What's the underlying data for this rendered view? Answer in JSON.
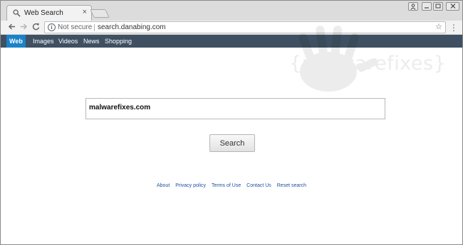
{
  "browser": {
    "tab_title": "Web Search",
    "tab_close": "×",
    "address": {
      "security_label": "Not secure",
      "url": "search.danabing.com"
    }
  },
  "site_nav": {
    "items": [
      "Web",
      "Images",
      "Videos",
      "News",
      "Shopping"
    ],
    "active": "Web"
  },
  "watermark": "{malwarefixes}",
  "search": {
    "query": "malwarefixes.com",
    "button_label": "Search"
  },
  "footer": {
    "links": [
      "About",
      "Privacy policy",
      "Terms of Use",
      "Contact Us",
      "Reset search"
    ]
  },
  "colors": {
    "nav_bar": "#3e5061",
    "nav_active": "#1a82c8",
    "footer_link": "#1f4fa3"
  }
}
